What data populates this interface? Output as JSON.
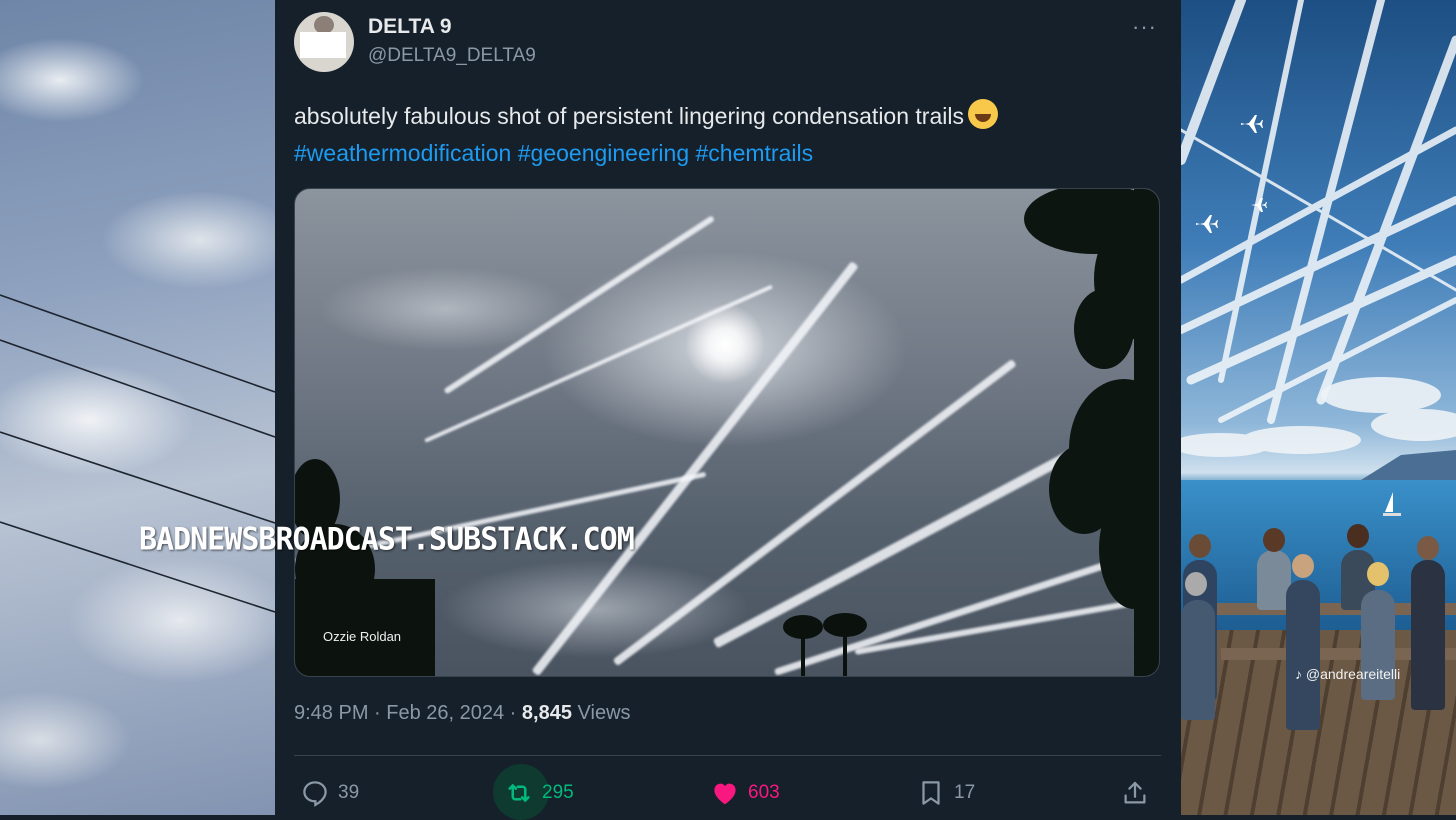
{
  "tweet": {
    "author_name": "DELTA 9",
    "author_handle": "@DELTA9_DELTA9",
    "text": "absolutely fabulous shot of persistent lingering condensation trails",
    "emoji_name": "rolling-on-floor-laughing-emoji",
    "hashtags": "#weathermodification #geoengineering #chemtrails",
    "photo_credit": "Ozzie Roldan",
    "time": "9:48 PM · Feb 26, 2024 · ",
    "views_count": "8,845",
    "views_label": " Views",
    "more_label": "···"
  },
  "actions": {
    "replies": "39",
    "retweets": "295",
    "likes": "603",
    "bookmarks": "17"
  },
  "overlay": {
    "watermark": "BADNEWSBROADCAST.SUBSTACK.COM",
    "right_credit": "♪ @andreareitelli"
  },
  "colors": {
    "background": "#15202b",
    "text": "#e7e9ea",
    "muted": "#8b98a5",
    "link": "#1d9bf0",
    "retweet": "#00ba7c",
    "like": "#f91880"
  }
}
